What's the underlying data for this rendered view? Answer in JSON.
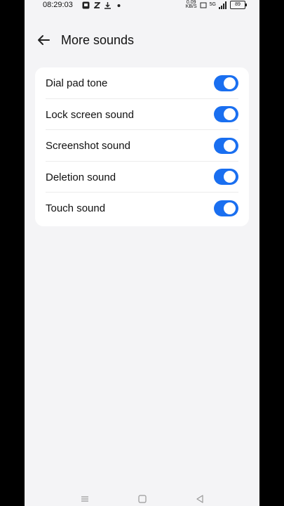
{
  "status_bar": {
    "time": "08:29:03",
    "net_speed_value": "0.09",
    "net_speed_unit": "KB/S",
    "signal_text": "5G",
    "battery": "89"
  },
  "header": {
    "title": "More sounds"
  },
  "settings": [
    {
      "label": "Dial pad tone",
      "enabled": true
    },
    {
      "label": "Lock screen sound",
      "enabled": true
    },
    {
      "label": "Screenshot sound",
      "enabled": true
    },
    {
      "label": "Deletion sound",
      "enabled": true
    },
    {
      "label": "Touch sound",
      "enabled": true
    }
  ],
  "colors": {
    "toggle_on": "#1a6ff0",
    "background": "#f4f4f6"
  },
  "icons": [
    "arrow-left-icon",
    "menu-icon",
    "home-icon",
    "back-triangle-icon"
  ]
}
